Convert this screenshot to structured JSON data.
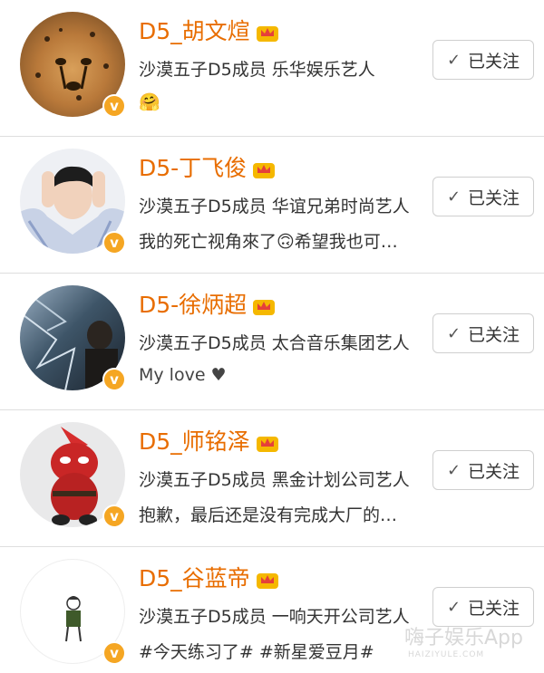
{
  "users": [
    {
      "name": "D5_胡文煊",
      "desc": "沙漠五子D5成员 乐华娱乐艺人",
      "bio": "🤗",
      "follow_label": "已关注",
      "avatar": "cheetah"
    },
    {
      "name": "D5-丁飞俊",
      "desc": "沙漠五子D5成员 华谊兄弟时尚艺人",
      "bio": "我的死亡视角來了🙃希望我也可…",
      "follow_label": "已关注",
      "avatar": "person"
    },
    {
      "name": "D5-徐炳超",
      "desc": "沙漠五子D5成员 太合音乐集团艺人",
      "bio": "My love ♥",
      "follow_label": "已关注",
      "avatar": "dark"
    },
    {
      "name": "D5_师铭泽",
      "desc": "沙漠五子D5成员 黑金计划公司艺人",
      "bio": "抱歉，最后还是没有完成大厂的…",
      "follow_label": "已关注",
      "avatar": "deadpool"
    },
    {
      "name": "D5_谷蓝帝",
      "desc": "沙漠五子D5成员 一响天开公司艺人",
      "bio": "#今天练习了# #新星爱豆月#",
      "follow_label": "已关注",
      "avatar": "sketch"
    }
  ],
  "watermark": {
    "text": "嗨子娱乐App",
    "sub": "HAIZIYULE.COM"
  },
  "colors": {
    "name": "#e86d00",
    "verified": "#f5a623",
    "divider": "#dedede"
  },
  "icons": {
    "verified": "verified-badge-icon",
    "crown": "crown-icon",
    "check": "check-icon"
  }
}
